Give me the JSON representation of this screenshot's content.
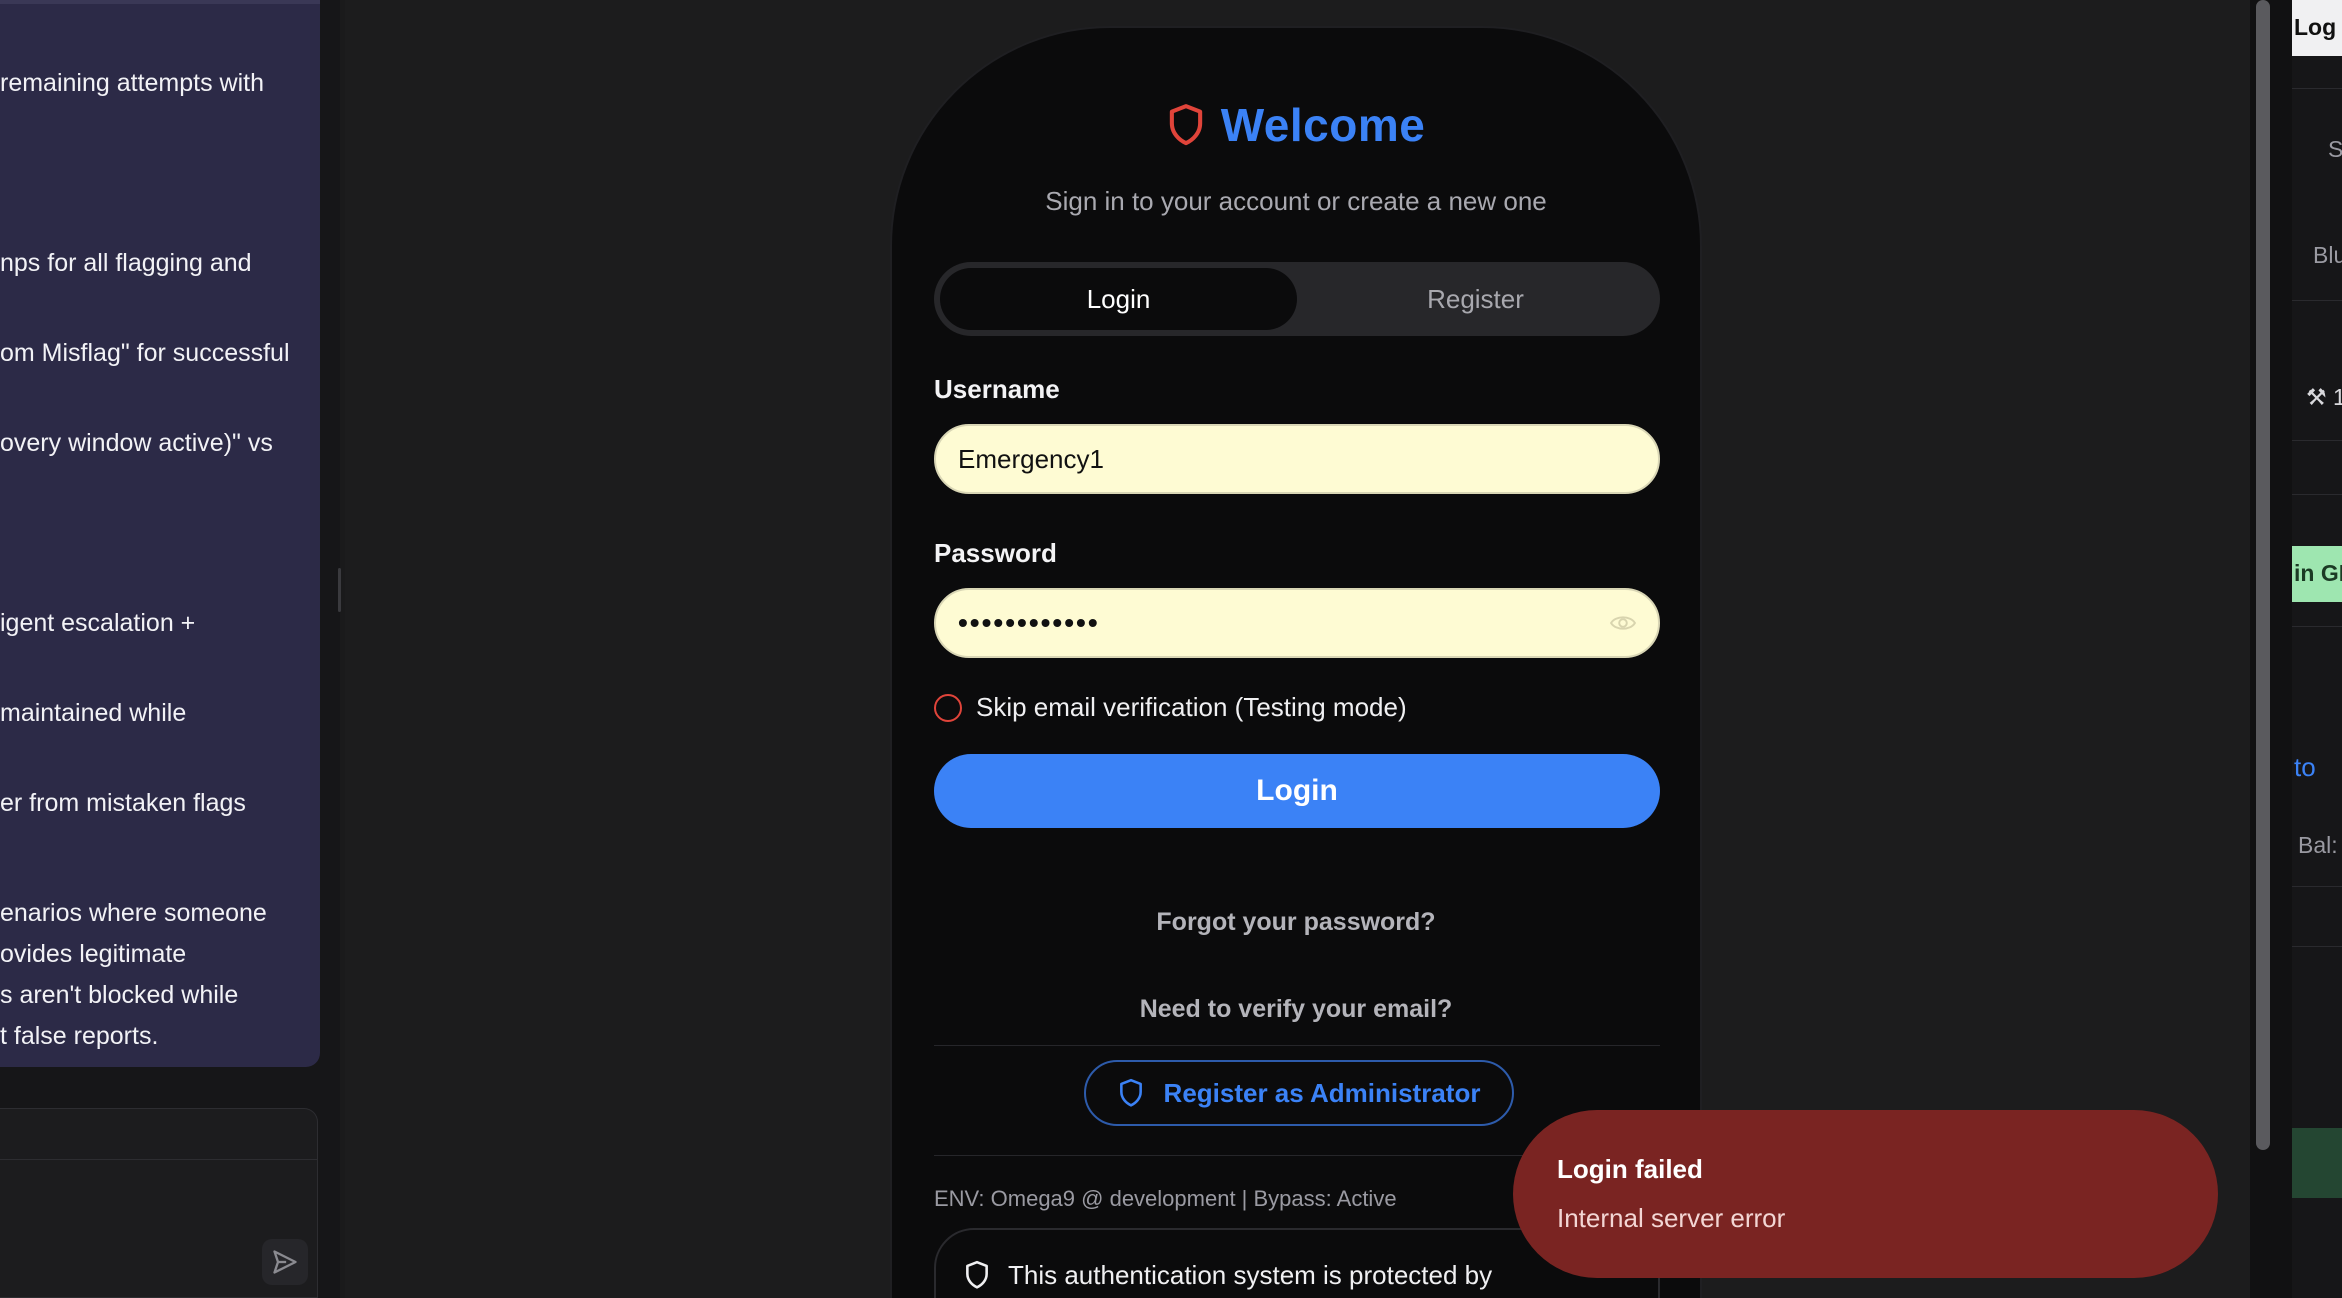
{
  "chat": {
    "lines": [
      "remaining attempts with",
      "nps for all flagging and",
      "om Misflag\" for successful",
      "overy window active)\" vs",
      "igent escalation +",
      "maintained while",
      "er from mistaken flags",
      "enarios where someone",
      "ovides legitimate",
      "s aren't blocked while",
      "t false reports."
    ]
  },
  "auth": {
    "title": "Welcome",
    "subtitle": "Sign in to your account or create a new one",
    "tabs": {
      "login": "Login",
      "register": "Register"
    },
    "username_label": "Username",
    "username_value": "Emergency1",
    "password_label": "Password",
    "password_value": "••••••••••••",
    "skip_verification_label": "Skip email verification (Testing mode)",
    "submit_label": "Login",
    "forgot_link": "Forgot your password?",
    "verify_link": "Need to verify your email?",
    "admin_button": "Register as Administrator",
    "env_info": "ENV: Omega9 @ development | Bypass: Active",
    "protection_notice": "This authentication system is protected by"
  },
  "toast": {
    "title": "Login failed",
    "message": "Internal server error"
  },
  "right_panel": {
    "fragments": [
      "Log I",
      "S",
      "Blu",
      "1",
      "in GI",
      "to",
      "Bal:"
    ]
  },
  "colors": {
    "accent": "#3b82f6",
    "shield": "#e0443a",
    "toast_bg": "#7a2422",
    "input_bg": "#fefbd3",
    "chat_bg": "#2c2a47"
  },
  "icons": [
    "shield-icon",
    "eye-icon",
    "send-icon",
    "shield-outline-icon"
  ]
}
